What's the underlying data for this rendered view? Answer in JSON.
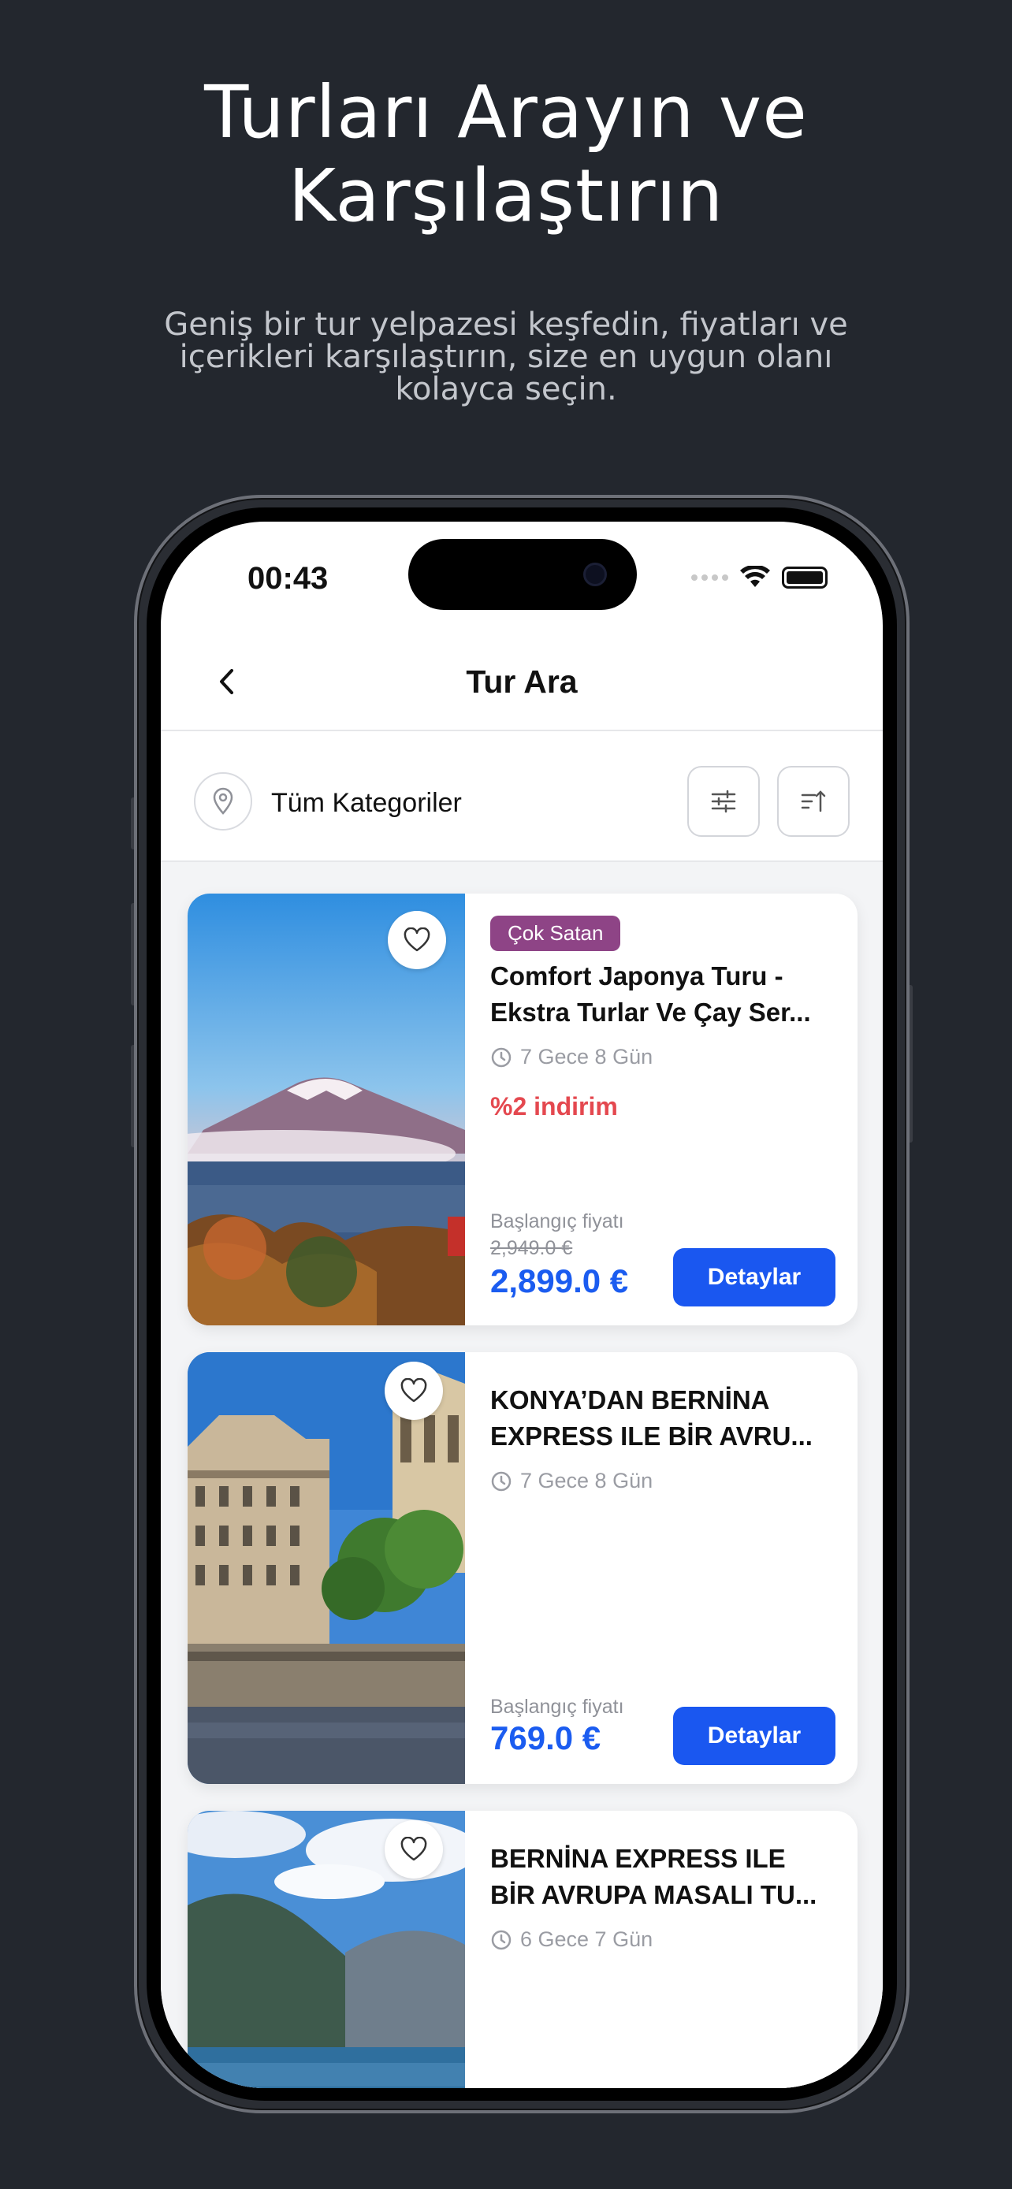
{
  "hero": {
    "title_line1": "Turları Arayın ve",
    "title_line2": "Karşılaştırın",
    "subtitle_line1": "Geniş bir tur yelpazesi keşfedin, fiyatları ve",
    "subtitle_line2": "içerikleri karşılaştırın, size en uygun olanı",
    "subtitle_line3": "kolayca seçin."
  },
  "status_bar": {
    "time": "00:43"
  },
  "nav": {
    "title": "Tur Ara",
    "back_icon": "chevron-left-icon"
  },
  "filter": {
    "category_label": "Tüm Kategoriler",
    "location_icon": "map-pin-icon",
    "filter_icon": "sliders-icon",
    "sort_icon": "sort-icon"
  },
  "tours": [
    {
      "badge": "Çok Satan",
      "title_line1": "Comfort Japonya Turu -",
      "title_line2": "Ekstra Turlar Ve Çay Ser...",
      "duration": "7 Gece 8 Gün",
      "discount": "%2 indirim",
      "price_label": "Başlangıç fiyatı",
      "old_price": "2,949.0 €",
      "price": "2,899.0 €",
      "button": "Detaylar"
    },
    {
      "title_line1": "KONYA’DAN BERNİNA",
      "title_line2": "EXPRESS ILE  BİR AVRU...",
      "duration": "7 Gece 8 Gün",
      "price_label": "Başlangıç fiyatı",
      "price": "769.0 €",
      "button": "Detaylar"
    },
    {
      "title_line1": "BERNİNA EXPRESS ILE",
      "title_line2": "BİR AVRUPA MASALI TU...",
      "duration": "6 Gece 7 Gün"
    }
  ],
  "colors": {
    "background": "#23272e",
    "accent_blue": "#1a57f0",
    "badge_purple": "#8e4486",
    "discount_red": "#e4484f"
  }
}
